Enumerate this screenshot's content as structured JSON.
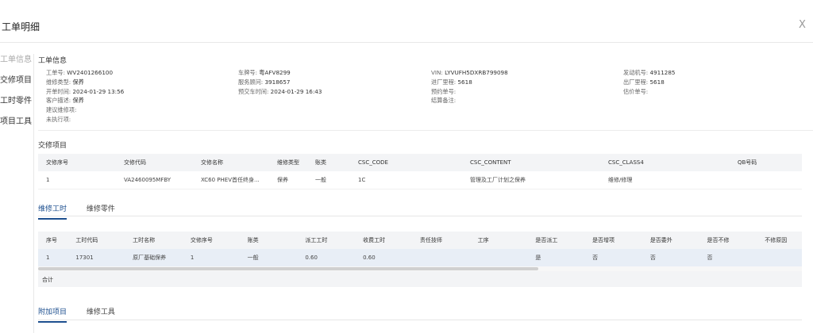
{
  "dialog": {
    "title": "工单明细",
    "close_glyph": "X"
  },
  "sidebar": {
    "items": [
      {
        "label": "工单信息",
        "dim": true
      },
      {
        "label": "交修项目",
        "dim": false
      },
      {
        "label": "工时零件",
        "dim": false
      },
      {
        "label": "项目工具",
        "dim": false
      }
    ]
  },
  "work_order": {
    "title": "工单信息",
    "fields": {
      "order_no_k": "工单号:",
      "order_no": "WV2401266100",
      "maint_type_k": "维修类型:",
      "maint_type": "保养",
      "open_time_k": "开单时间:",
      "open_time": "2024-01-29 13:56",
      "customer_desc_k": "客户描述:",
      "customer_desc": "保养",
      "suggest_k": "建议维修项:",
      "suggest": "",
      "unexec_k": "未执行项:",
      "unexec": "",
      "plate_k": "车牌号:",
      "plate": "粤AFV8299",
      "advisor_k": "服务顾问:",
      "advisor": "3918657",
      "pickup_k": "预交车时间:",
      "pickup": "2024-01-29 16:43",
      "vin_k": "VIN:",
      "vin": "LYVUFH5DXRB799098",
      "in_mileage_k": "进厂里程:",
      "in_mileage": "5618",
      "appt_k": "预约单号:",
      "appt": "",
      "settle_k": "结算备注:",
      "settle": "",
      "engine_k": "发动机号:",
      "engine": "4911285",
      "out_mileage_k": "出厂里程:",
      "out_mileage": "5618",
      "quote_k": "估价单号:",
      "quote": ""
    }
  },
  "repair_items": {
    "title": "交修项目",
    "headers": [
      "交修序号",
      "交修代码",
      "交修名称",
      "维修类型",
      "账类",
      "CSC_CODE",
      "CSC_CONTENT",
      "CSC_CLASS4",
      "QB号码"
    ],
    "rows": [
      [
        "1",
        "VA2460095MFBY",
        "XC60 PHEV首任终身...",
        "保养",
        "一般",
        "1C",
        "管理及工厂计划之保养",
        "维修/修理",
        ""
      ]
    ]
  },
  "labor_tabs": {
    "tabs": [
      "维修工时",
      "维修零件"
    ],
    "active": 0
  },
  "labor_table": {
    "headers": [
      "序号",
      "工时代码",
      "工时名称",
      "交修序号",
      "账类",
      "派工工时",
      "收费工时",
      "责任技师",
      "工序",
      "是否派工",
      "是否增项",
      "是否委外",
      "是否不修",
      "不修原因"
    ],
    "rows": [
      [
        "1",
        "17301",
        "原厂基础保养",
        "1",
        "一般",
        "0.60",
        "0.60",
        "",
        "",
        "是",
        "否",
        "否",
        "否",
        ""
      ]
    ],
    "total_label": "合计"
  },
  "extra_tabs": {
    "tabs": [
      "附加项目",
      "维修工具"
    ],
    "active": 0
  }
}
